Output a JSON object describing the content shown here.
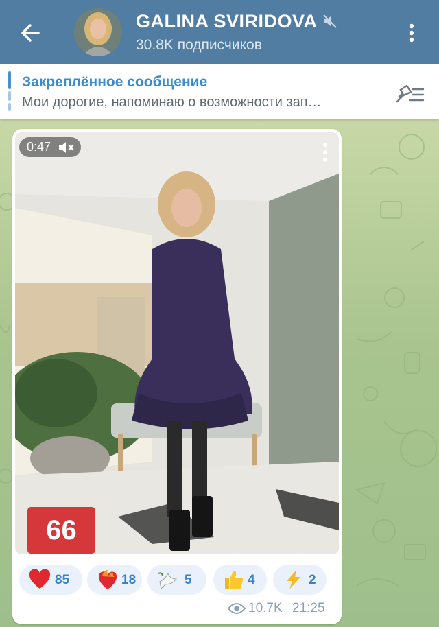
{
  "header": {
    "channel_name": "GALINA SVIRIDOVA",
    "subscribers": "30.8K подписчиков",
    "icons": [
      "back-arrow-icon",
      "muted-icon",
      "more-vertical-icon"
    ]
  },
  "pinned": {
    "title": "Закреплённое сообщение",
    "text": "Мои дорогие, напоминаю о возможности зап…",
    "icon": "unpin-list-icon"
  },
  "message": {
    "video": {
      "duration": "0:47",
      "sound": "muted-speaker-icon",
      "overlay_number": "66"
    },
    "reactions": [
      {
        "emoji": "heart",
        "count": "85"
      },
      {
        "emoji": "heart-on-fire",
        "count": "18"
      },
      {
        "emoji": "dove",
        "count": "5"
      },
      {
        "emoji": "thumbs-up",
        "count": "4"
      },
      {
        "emoji": "lightning",
        "count": "2"
      }
    ],
    "views": "10.7K",
    "time": "21:25"
  },
  "colors": {
    "header_bg": "#517da2",
    "accent": "#3a8bd0",
    "reaction_bg": "#eaf1fa",
    "badge_red": "#d6373a"
  }
}
